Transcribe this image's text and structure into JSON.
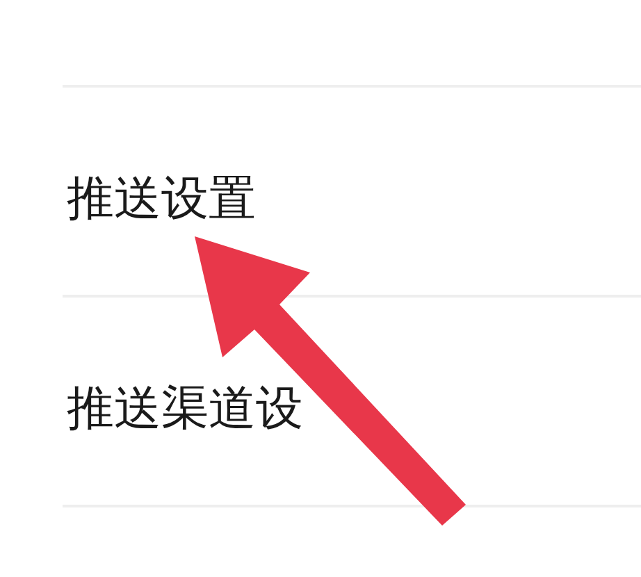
{
  "settings_list": {
    "items": [
      {
        "label": "推送设置"
      },
      {
        "label": "推送渠道设"
      }
    ]
  }
}
